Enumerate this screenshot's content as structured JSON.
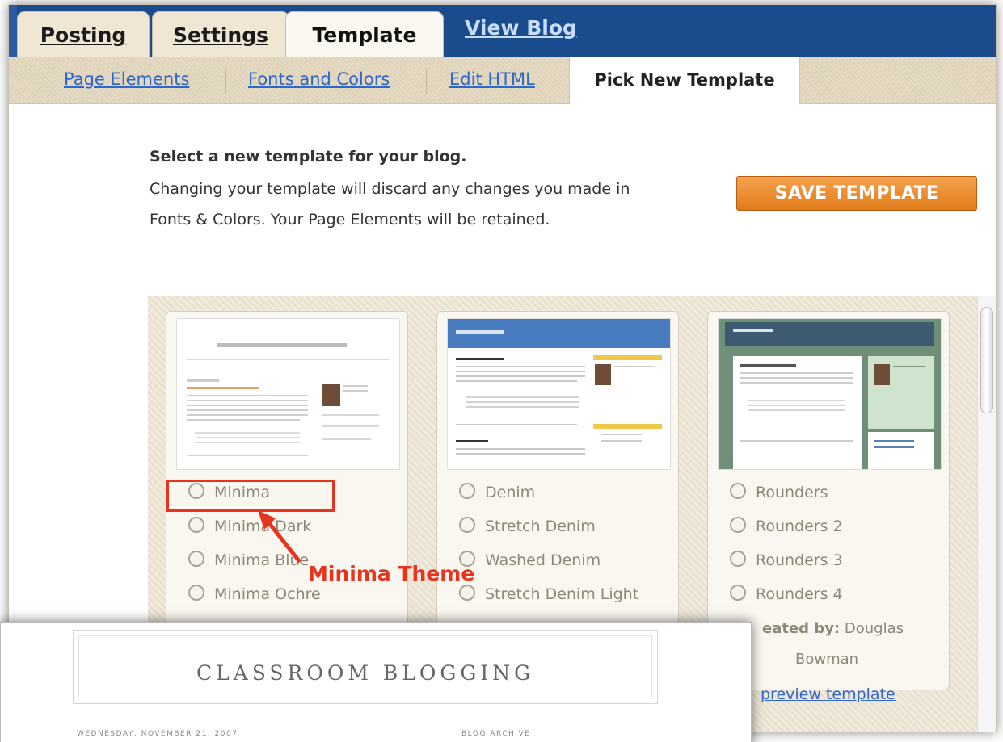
{
  "tabs": {
    "posting": "Posting",
    "settings": "Settings",
    "template": "Template",
    "view_blog": "View Blog"
  },
  "subtabs": {
    "page_elements": "Page Elements",
    "fonts_colors": "Fonts and Colors",
    "edit_html": "Edit HTML",
    "pick_new": "Pick New Template"
  },
  "instructions": {
    "title": "Select a new template for your blog.",
    "line1": "Changing your template will discard any changes you made in",
    "line2": "Fonts & Colors. Your Page Elements will be retained."
  },
  "save_button": "SAVE TEMPLATE",
  "templates": [
    {
      "options": [
        "Minima",
        "Minima Dark",
        "Minima Blue",
        "Minima Ochre"
      ]
    },
    {
      "options": [
        "Denim",
        "Stretch Denim",
        "Washed Denim",
        "Stretch Denim Light"
      ]
    },
    {
      "options": [
        "Rounders",
        "Rounders 2",
        "Rounders 3",
        "Rounders 4"
      ]
    }
  ],
  "credit": {
    "prefix": "eated by:",
    "name": "Douglas",
    "name2": "Bowman"
  },
  "preview_link": "preview template",
  "annotation": "Minima Theme",
  "blog": {
    "title": "CLASSROOM BLOGGING",
    "date": "WEDNESDAY, NOVEMBER 21, 2007",
    "archive": "BLOG ARCHIVE"
  },
  "colors": {
    "accent": "#e8331e",
    "tab_bar": "#1a4c8d",
    "save": "#e9892a"
  }
}
